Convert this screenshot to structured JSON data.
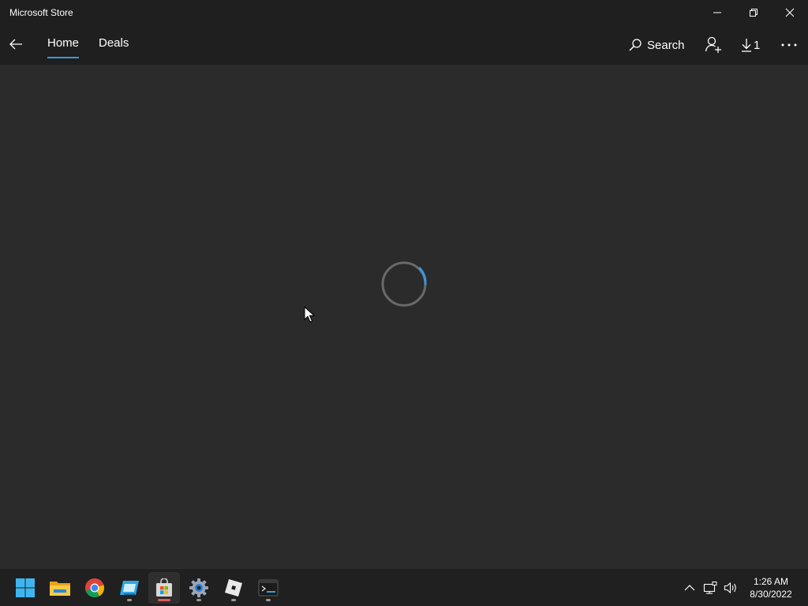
{
  "window": {
    "title": "Microsoft Store"
  },
  "nav": {
    "tabs": [
      {
        "label": "Home",
        "active": true
      },
      {
        "label": "Deals",
        "active": false
      }
    ],
    "search_label": "Search",
    "downloads_count": "1"
  },
  "content": {
    "state": "loading"
  },
  "taskbar": {
    "apps": [
      {
        "name": "start",
        "icon": "windows-logo-icon"
      },
      {
        "name": "file-explorer",
        "icon": "folder-icon"
      },
      {
        "name": "chrome",
        "icon": "chrome-icon"
      },
      {
        "name": "app-4",
        "icon": "window-app-icon",
        "running": true
      },
      {
        "name": "microsoft-store",
        "icon": "store-bag-icon",
        "running": true,
        "active": true
      },
      {
        "name": "settings",
        "icon": "gear-icon",
        "running": true
      },
      {
        "name": "roblox",
        "icon": "roblox-icon",
        "running": true
      },
      {
        "name": "terminal",
        "icon": "terminal-icon",
        "running": true
      }
    ],
    "time": "1:26 AM",
    "date": "8/30/2022"
  },
  "colors": {
    "accent": "#3a96dd",
    "background": "#2b2b2b",
    "chrome": "#1f1f1f",
    "taskbar": "#202020"
  }
}
